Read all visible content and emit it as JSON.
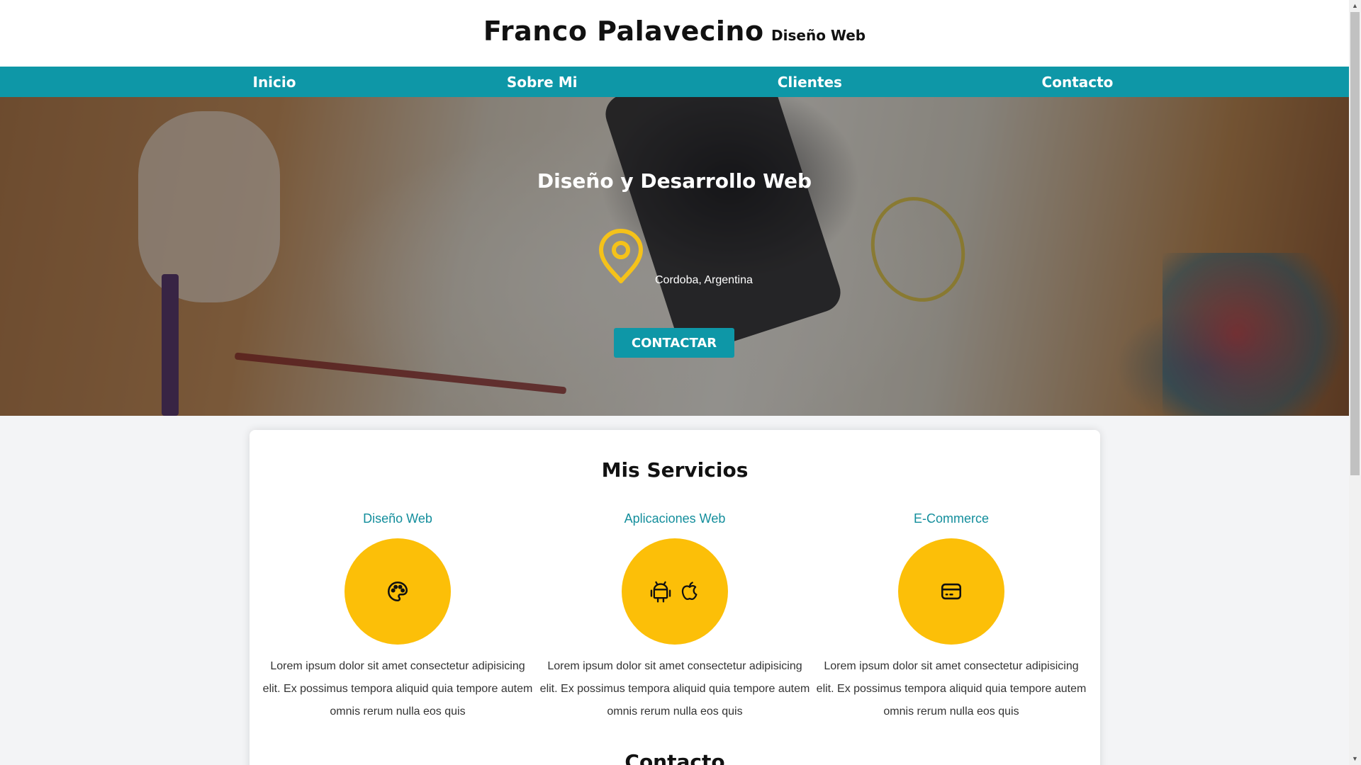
{
  "header": {
    "name": "Franco Palavecino",
    "tagline": "Diseño Web"
  },
  "nav": {
    "items": [
      {
        "label": "Inicio"
      },
      {
        "label": "Sobre Mi"
      },
      {
        "label": "Clientes"
      },
      {
        "label": "Contacto"
      }
    ]
  },
  "hero": {
    "title": "Diseño y Desarrollo Web",
    "location": "Cordoba, Argentina",
    "cta_label": "CONTACTAR",
    "pin_icon": "map-pin-icon"
  },
  "services": {
    "title": "Mis Servicios",
    "items": [
      {
        "title": "Diseño Web",
        "icon": "palette-icon",
        "description": "Lorem ipsum dolor sit amet consectetur adipisicing elit. Ex possimus tempora aliquid quia tempore autem omnis rerum nulla eos quis"
      },
      {
        "title": "Aplicaciones Web",
        "icon": "android-apple-icon",
        "description": "Lorem ipsum dolor sit amet consectetur adipisicing elit. Ex possimus tempora aliquid quia tempore autem omnis rerum nulla eos quis"
      },
      {
        "title": "E-Commerce",
        "icon": "credit-card-icon",
        "description": "Lorem ipsum dolor sit amet consectetur adipisicing elit. Ex possimus tempora aliquid quia tempore autem omnis rerum nulla eos quis"
      }
    ]
  },
  "contact": {
    "title": "Contacto"
  },
  "colors": {
    "primary": "#0e97a7",
    "accent": "#fcbf08",
    "service_title": "#138e9c"
  }
}
